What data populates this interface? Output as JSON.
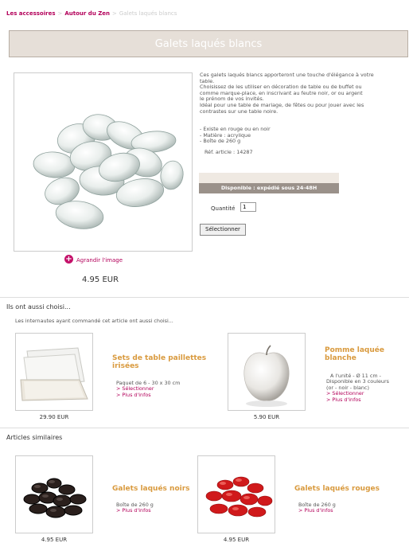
{
  "breadcrumb": {
    "item1": "Les accessoires",
    "sep1": ">",
    "item2": "Autour du Zen",
    "sep2": ">",
    "current": "Galets laqués blancs"
  },
  "product": {
    "title": "Galets laqués blancs",
    "desc_lines": [
      "Ces galets laqués blancs apporteront une touche d'élégance à votre",
      "table.",
      "Choisissez de les utiliser en décoration de table ou de buffet ou",
      "comme marque-place, en inscrivant au feutre noir, or ou argent",
      "le prénom de vos invités.",
      "Idéal pour une table de mariage, de fêtes ou pour jouer avec les",
      "contrastes sur une table noire."
    ],
    "bullet1": "- Existe en rouge ou en noir",
    "bullet2": "- Matière : acrylique",
    "bullet3": "- Boîte de 260 g",
    "ref": "Réf. article : 14287",
    "availability": "Disponible : expédié sous 24-48H",
    "quantity_label": "Quantité",
    "quantity_value": "1",
    "select_label": "Sélectionner",
    "enlarge_label": "Agrandir l'image",
    "price": "4.95 EUR"
  },
  "also_chosen": {
    "title": "Ils ont aussi choisi...",
    "subtitle": "Les internautes ayant commandé cet article ont aussi choisi...",
    "items": [
      {
        "name": "Sets de table paillettes irisées",
        "name_line1": "Sets de table paillettes",
        "name_line2": "irisées",
        "info": "Paquet de 6 - 30 x 30 cm",
        "select": "> Sélectionner",
        "more": "> Plus d'infos",
        "price": "29.90 EUR"
      },
      {
        "name": "Pomme laquée blanche",
        "name_line1": "Pomme laquée",
        "name_line2": "blanche",
        "info1": "A l'unité - Ø 11 cm -",
        "info2": "Disponible en 3 couleurs",
        "info3": "(or - noir - blanc)",
        "select": "> Sélectionner",
        "more": "> Plus d'infos",
        "price": "5.90 EUR"
      }
    ]
  },
  "similar": {
    "title": "Articles similaires",
    "items": [
      {
        "name": "Galets laqués noirs",
        "info": "Boîte de 260 g",
        "more": "> Plus d'infos",
        "price": "4.95 EUR"
      },
      {
        "name": "Galets laqués rouges",
        "info": "Boîte de 260 g",
        "more": "> Plus d'infos",
        "price": "4.95 EUR"
      }
    ]
  },
  "icons": {
    "enlarge": "plus-circle-icon"
  },
  "colors": {
    "accent": "#b3005a",
    "title_bar": "#e6dfd8",
    "product_title": "#d99a3e",
    "stock_bar": "#9a918a"
  }
}
